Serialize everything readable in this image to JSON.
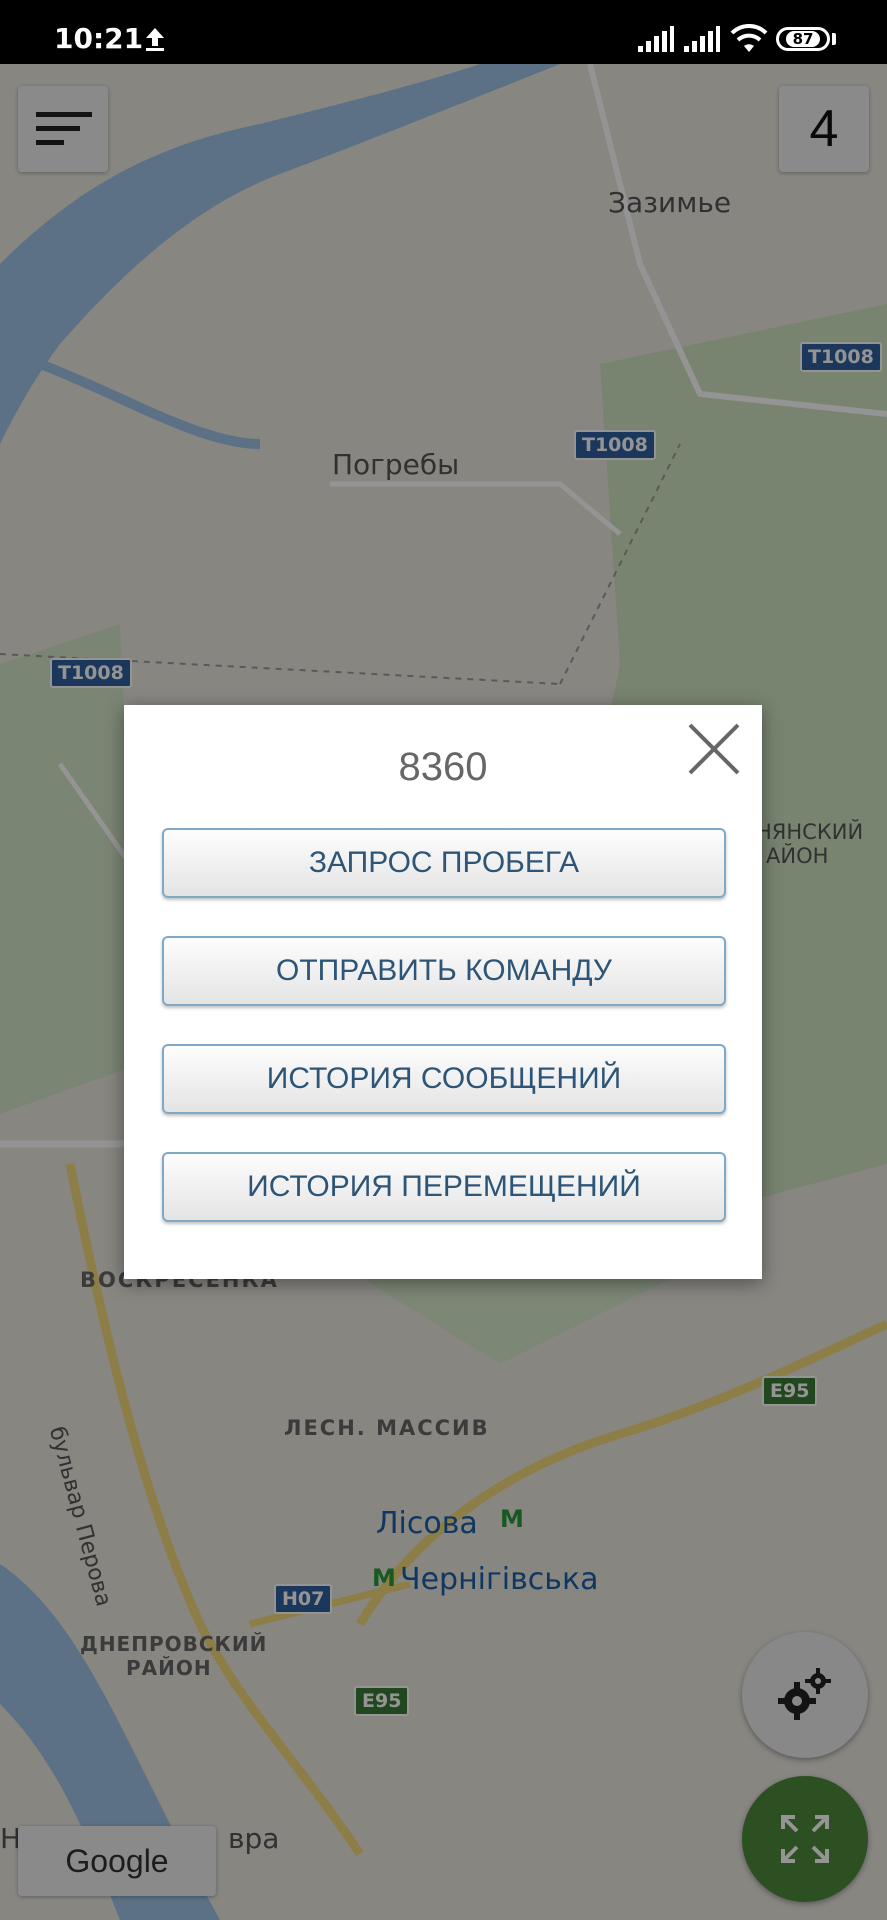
{
  "status_bar": {
    "time": "10:21",
    "battery": "87"
  },
  "map": {
    "labels": {
      "zazimye": "Зазимье",
      "pogreby": "Погребы",
      "voskresenka": "ВОСКРЕСЕНКА",
      "lesn_massiv": "ЛЕСН. МАССИВ",
      "bulvar_perova": "бульвар Перова",
      "lisova": "Лісова",
      "chernihivska": "Чернігівська",
      "dneprovsky_1": "ДНЕПРОВСКИЙ",
      "dneprovsky_2": "РАЙОН",
      "desnyansky_1": "НЯНСКИЙ",
      "desnyansky_2": "АЙОН",
      "vra": "вра",
      "ie": "Не"
    },
    "roads": {
      "t1008_a": "T1008",
      "t1008_b": "T1008",
      "t1008_c": "T1008",
      "e95_a": "E95",
      "e95_b": "E95",
      "h07": "H07"
    }
  },
  "header": {
    "vehicle_count": "4"
  },
  "footer": {
    "google_label": "Google"
  },
  "dialog": {
    "title": "8360",
    "buttons": {
      "mileage": "ЗАПРОС ПРОБЕГА",
      "send_command": "ОТПРАВИТЬ КОМАНДУ",
      "message_history": "ИСТОРИЯ СООБЩЕНИЙ",
      "movement_history": "ИСТОРИЯ ПЕРЕМЕЩЕНИЙ"
    }
  }
}
